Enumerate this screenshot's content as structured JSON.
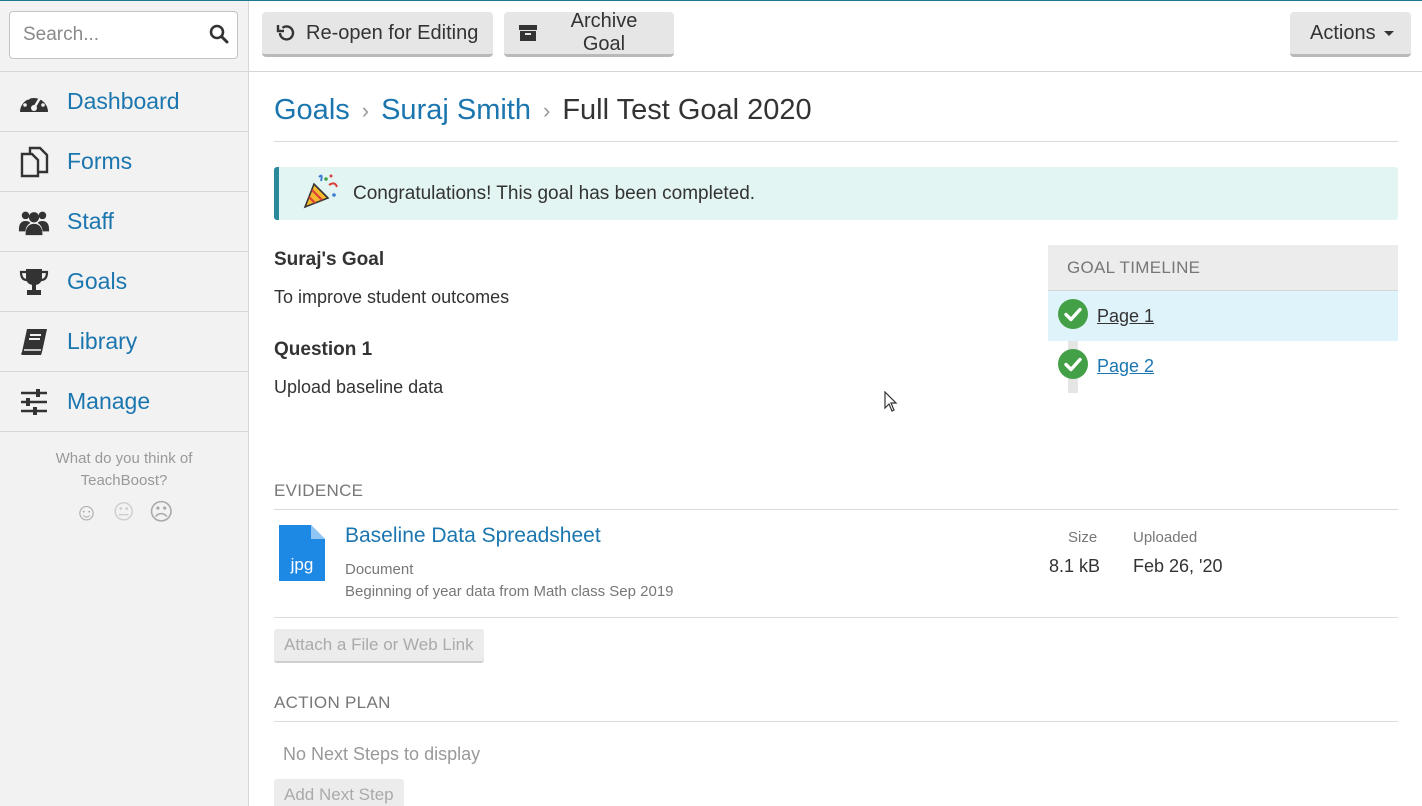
{
  "search": {
    "placeholder": "Search..."
  },
  "sidebar": {
    "items": [
      {
        "label": "Dashboard",
        "icon": "dashboard-icon"
      },
      {
        "label": "Forms",
        "icon": "forms-icon"
      },
      {
        "label": "Staff",
        "icon": "staff-icon"
      },
      {
        "label": "Goals",
        "icon": "trophy-icon"
      },
      {
        "label": "Library",
        "icon": "book-icon"
      },
      {
        "label": "Manage",
        "icon": "sliders-icon"
      }
    ],
    "feedback_question": "What do you think of TeachBoost?",
    "faces": [
      "☺",
      "😐",
      "☹"
    ]
  },
  "toolbar": {
    "reopen_label": "Re-open for Editing",
    "archive_label": "Archive Goal",
    "actions_label": "Actions"
  },
  "breadcrumb": {
    "root": "Goals",
    "person": "Suraj Smith",
    "current": "Full Test Goal 2020"
  },
  "alert": {
    "text": "Congratulations! This goal has been completed."
  },
  "goal": {
    "title": "Suraj's Goal",
    "text": "To improve student outcomes",
    "question_title": "Question 1",
    "question_text": "Upload baseline data"
  },
  "timeline": {
    "header": "GOAL TIMELINE",
    "items": [
      {
        "label": "Page 1",
        "active": true
      },
      {
        "label": "Page 2",
        "active": false
      }
    ]
  },
  "evidence": {
    "section_title": "EVIDENCE",
    "items": [
      {
        "file_ext": "jpg",
        "title": "Baseline Data Spreadsheet",
        "type": "Document",
        "description": "Beginning of year data from Math class Sep 2019",
        "size_header": "Size",
        "size": "8.1 kB",
        "uploaded_header": "Uploaded",
        "uploaded": "Feb 26, '20"
      }
    ],
    "attach_label": "Attach a File or Web Link"
  },
  "action_plan": {
    "section_title": "ACTION PLAN",
    "empty_text": "No Next Steps to display",
    "add_label": "Add Next Step"
  },
  "colors": {
    "link": "#1b76b0",
    "accent": "#2a8a9c",
    "success": "#43a047",
    "alert_bg": "#e3f5f3"
  }
}
